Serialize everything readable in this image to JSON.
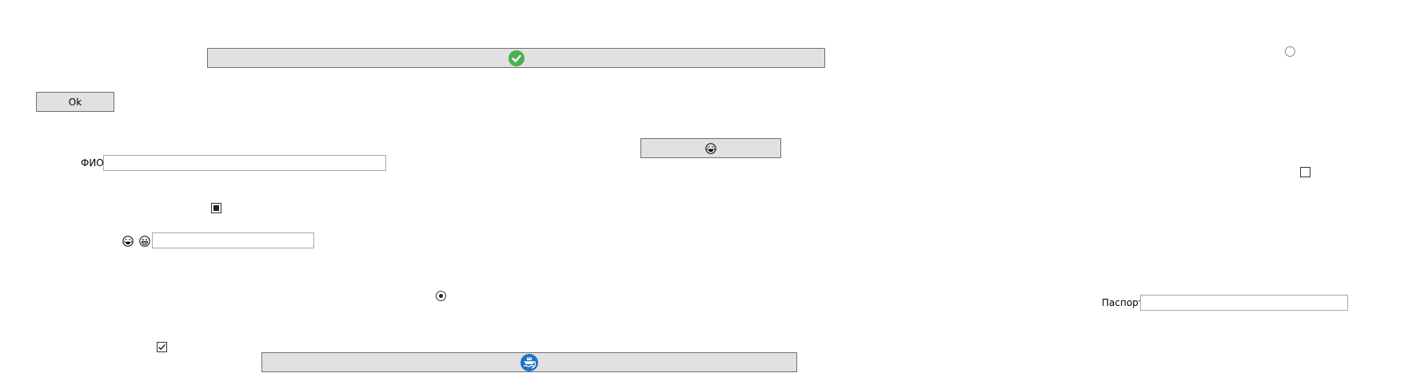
{
  "buttons": {
    "top_wide": {
      "icon": "green-check-icon",
      "icon_color": "#4caf50"
    },
    "ok": {
      "label": "Ok"
    },
    "emoji_button": {
      "icon": "laughing-face-icon"
    },
    "bottom_wide": {
      "icon": "blue-boat-icon",
      "icon_color": "#1e73c8"
    }
  },
  "fields": {
    "fio": {
      "label": "ФИО",
      "value": "",
      "placeholder": ""
    },
    "emoji_field": {
      "label_icons": [
        "laughing-face-icon",
        "grinning-face-icon"
      ],
      "value": "",
      "placeholder": ""
    },
    "passport": {
      "label": "Паспорт",
      "value": "",
      "placeholder": ""
    }
  },
  "checkboxes": {
    "indeterminate": {
      "state": "indeterminate"
    },
    "checked": {
      "state": "checked"
    },
    "unchecked": {
      "state": "unchecked"
    }
  },
  "radios": {
    "selected": {
      "state": "selected"
    },
    "unselected": {
      "state": "unselected"
    }
  },
  "colors": {
    "button_bg": "#e1e1e1",
    "button_border": "#adadad",
    "textbox_border": "#a9a9a9",
    "check_green": "#4caf50",
    "boat_blue": "#1e73c8"
  }
}
